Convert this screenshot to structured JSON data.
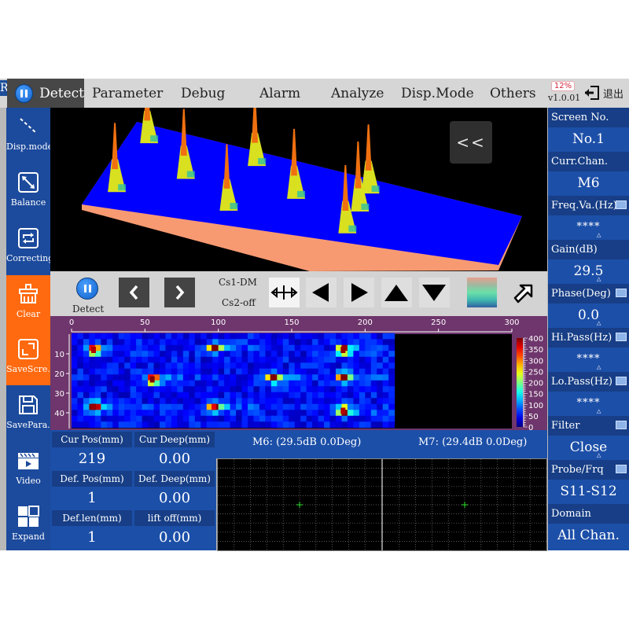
{
  "topbar": {
    "corner_letter": "R",
    "active_tab": "Detect",
    "menu": [
      "Parameter",
      "Debug",
      "Alarm",
      "Analyze",
      "Disp.Mode",
      "Others"
    ],
    "battery": "12%",
    "version": "v1.0.01",
    "exit_label": "退出"
  },
  "sidebar": {
    "items": [
      {
        "label": "Disp.mode",
        "icon": "display-mode-icon",
        "active": false
      },
      {
        "label": "Balance",
        "icon": "balance-icon",
        "active": false
      },
      {
        "label": "Correcting",
        "icon": "correcting-icon",
        "active": false
      },
      {
        "label": "Clear",
        "icon": "clear-brush-icon",
        "active": true
      },
      {
        "label": "SaveScre.",
        "icon": "save-screen-icon",
        "active": true
      },
      {
        "label": "SavePara.",
        "icon": "save-param-icon",
        "active": false
      },
      {
        "label": "Video",
        "icon": "video-icon",
        "active": false
      },
      {
        "label": "Expand",
        "icon": "expand-icon",
        "active": false
      }
    ]
  },
  "view3d": {
    "collapse_label": "<<"
  },
  "toolbar": {
    "detect_label": "Detect",
    "cs1": "Cs1-DM",
    "cs2": "Cs2-off"
  },
  "chart_data": {
    "type": "heatmap",
    "title": "",
    "xlabel": "",
    "ylabel": "",
    "x_ticks": [
      0,
      50,
      100,
      150,
      200,
      250,
      300
    ],
    "y_ticks": [
      10,
      20,
      30,
      40
    ],
    "xlim": [
      0,
      300
    ],
    "ylim": [
      0,
      48
    ],
    "colorbar": {
      "min": 0,
      "max": 400,
      "ticks": [
        0,
        50,
        100,
        150,
        200,
        250,
        300,
        350,
        400
      ]
    },
    "data_extent_x": [
      0,
      220
    ],
    "hotspots": [
      {
        "x": 15,
        "y": 8,
        "value": 380
      },
      {
        "x": 15,
        "y": 37,
        "value": 390
      },
      {
        "x": 55,
        "y": 23,
        "value": 400
      },
      {
        "x": 97,
        "y": 7,
        "value": 400
      },
      {
        "x": 97,
        "y": 37,
        "value": 360
      },
      {
        "x": 137,
        "y": 22,
        "value": 400
      },
      {
        "x": 185,
        "y": 8,
        "value": 390
      },
      {
        "x": 185,
        "y": 22,
        "value": 400
      },
      {
        "x": 185,
        "y": 39,
        "value": 380
      }
    ]
  },
  "info": {
    "cells": [
      {
        "label": "Cur Pos(mm)",
        "value": "219"
      },
      {
        "label": "Cur Deep(mm)",
        "value": "0.00"
      },
      {
        "label": "Def. Pos(mm)",
        "value": "1"
      },
      {
        "label": "Def. Deep(mm)",
        "value": "0.00"
      },
      {
        "label": "Def.len(mm)",
        "value": "1"
      },
      {
        "label": "lift off(mm)",
        "value": "0.00"
      }
    ]
  },
  "scopes": [
    {
      "title": "M6: (29.5dB 0.0Deg)"
    },
    {
      "title": "M7: (29.4dB 0.0Deg)"
    }
  ],
  "rpanel": {
    "fields": [
      {
        "label": "Screen No.",
        "value": "No.1",
        "keyboard": false,
        "cursor": false
      },
      {
        "label": "Curr.Chan.",
        "value": "M6",
        "keyboard": false,
        "cursor": false
      },
      {
        "label": "Freq.Va.(Hz)",
        "value": "****",
        "keyboard": true,
        "cursor": true
      },
      {
        "label": "Gain(dB)",
        "value": "29.5",
        "keyboard": false,
        "cursor": true
      },
      {
        "label": "Phase(Deg)",
        "value": "0.0",
        "keyboard": true,
        "cursor": true
      },
      {
        "label": "Hi.Pass(Hz)",
        "value": "****",
        "keyboard": true,
        "cursor": true
      },
      {
        "label": "Lo.Pass(Hz)",
        "value": "****",
        "keyboard": true,
        "cursor": true
      },
      {
        "label": "Filter",
        "value": "Close",
        "keyboard": true,
        "cursor": true
      },
      {
        "label": "Probe/Frq",
        "value": "S11-S12",
        "keyboard": true,
        "cursor": false
      },
      {
        "label": "Domain",
        "value": "All Chan.",
        "keyboard": false,
        "cursor": false
      }
    ]
  },
  "colors": {
    "primary_blue": "#1c4fa8",
    "header_blue": "#173e86",
    "active_orange": "#ff6a10",
    "cscan_frame": "#6e366c",
    "surface_blue": "#0000ff",
    "surface_edge": "#f79a72"
  }
}
